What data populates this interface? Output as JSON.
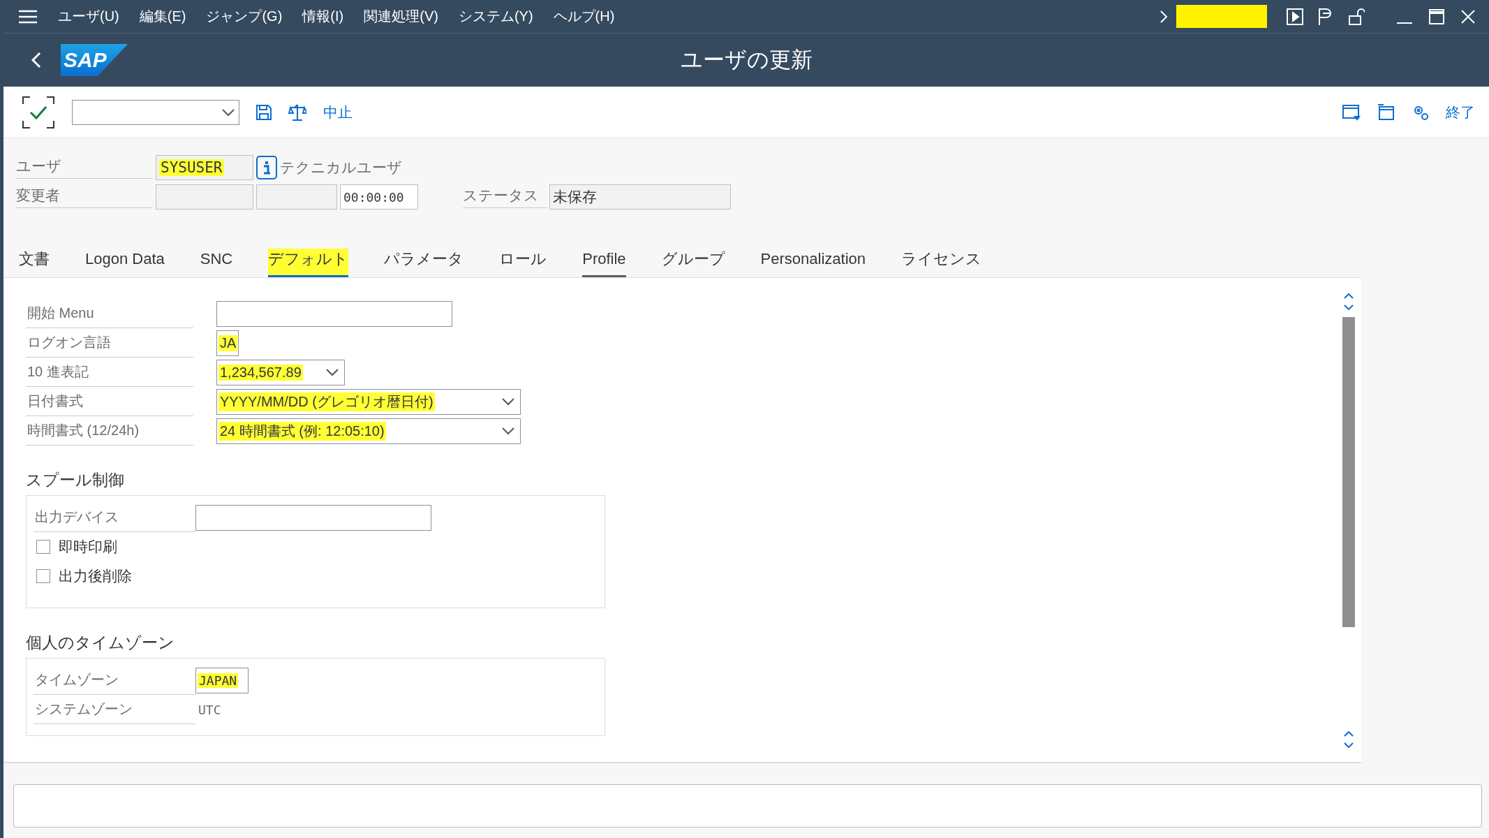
{
  "menu_bar": {
    "items": [
      "ユーザ(U)",
      "編集(E)",
      "ジャンプ(G)",
      "情報(I)",
      "関連処理(V)",
      "システム(Y)",
      "ヘルプ(H)"
    ]
  },
  "title_bar": {
    "logo": "SAP",
    "title": "ユーザの更新"
  },
  "toolbar": {
    "left_buttons": [
      "中止"
    ],
    "right_buttons": [
      "終了"
    ]
  },
  "header": {
    "user": {
      "label": "ユーザ",
      "value": "SYSUSER",
      "highlighted": true,
      "user_type": "テクニカルユーザ"
    },
    "changed_by": {
      "label": "変更者",
      "time": "00:00:00"
    },
    "status": {
      "label": "ステータス",
      "value": "未保存"
    }
  },
  "tabs": [
    {
      "label": "文書",
      "selected": false,
      "focused": false
    },
    {
      "label": "Logon Data",
      "selected": false,
      "focused": false
    },
    {
      "label": "SNC",
      "selected": false,
      "focused": false
    },
    {
      "label": "デフォルト",
      "selected": true,
      "focused": false,
      "highlighted": true
    },
    {
      "label": "パラメータ",
      "selected": false,
      "focused": false
    },
    {
      "label": "ロール",
      "selected": false,
      "focused": false
    },
    {
      "label": "Profile",
      "selected": false,
      "focused": true
    },
    {
      "label": "グループ",
      "selected": false,
      "focused": false
    },
    {
      "label": "Personalization",
      "selected": false,
      "focused": false
    },
    {
      "label": "ライセンス",
      "selected": false,
      "focused": false
    }
  ],
  "defaults": [
    {
      "kind": "input",
      "label": "開始 Menu"
    },
    {
      "kind": "input",
      "label": "ログオン言語",
      "value": "JA",
      "highlighted": true
    },
    {
      "kind": "dropdown",
      "label": "10 進表記",
      "value": "1,234,567.89",
      "highlighted": true
    },
    {
      "kind": "dropdown",
      "label": "日付書式",
      "value": "YYYY/MM/DD (グレゴリオ暦日付)",
      "highlighted": true
    },
    {
      "kind": "dropdown",
      "label": "時間書式 (12/24h)",
      "value": "24 時間書式 (例: 12:05:10)",
      "highlighted": true
    }
  ],
  "spool": {
    "title": "スプール制御",
    "output_device": {
      "label": "出力デバイス"
    },
    "options": [
      {
        "label": "即時印刷",
        "checked": false
      },
      {
        "label": "出力後削除",
        "checked": false
      }
    ]
  },
  "timezone": {
    "title": "個人のタイムゾーン",
    "rows": [
      {
        "kind": "input",
        "label": "タイムゾーン",
        "value": "JAPAN",
        "highlighted": true
      },
      {
        "kind": "text",
        "label": "システムゾーン",
        "value": "UTC",
        "highlighted": false
      }
    ]
  }
}
